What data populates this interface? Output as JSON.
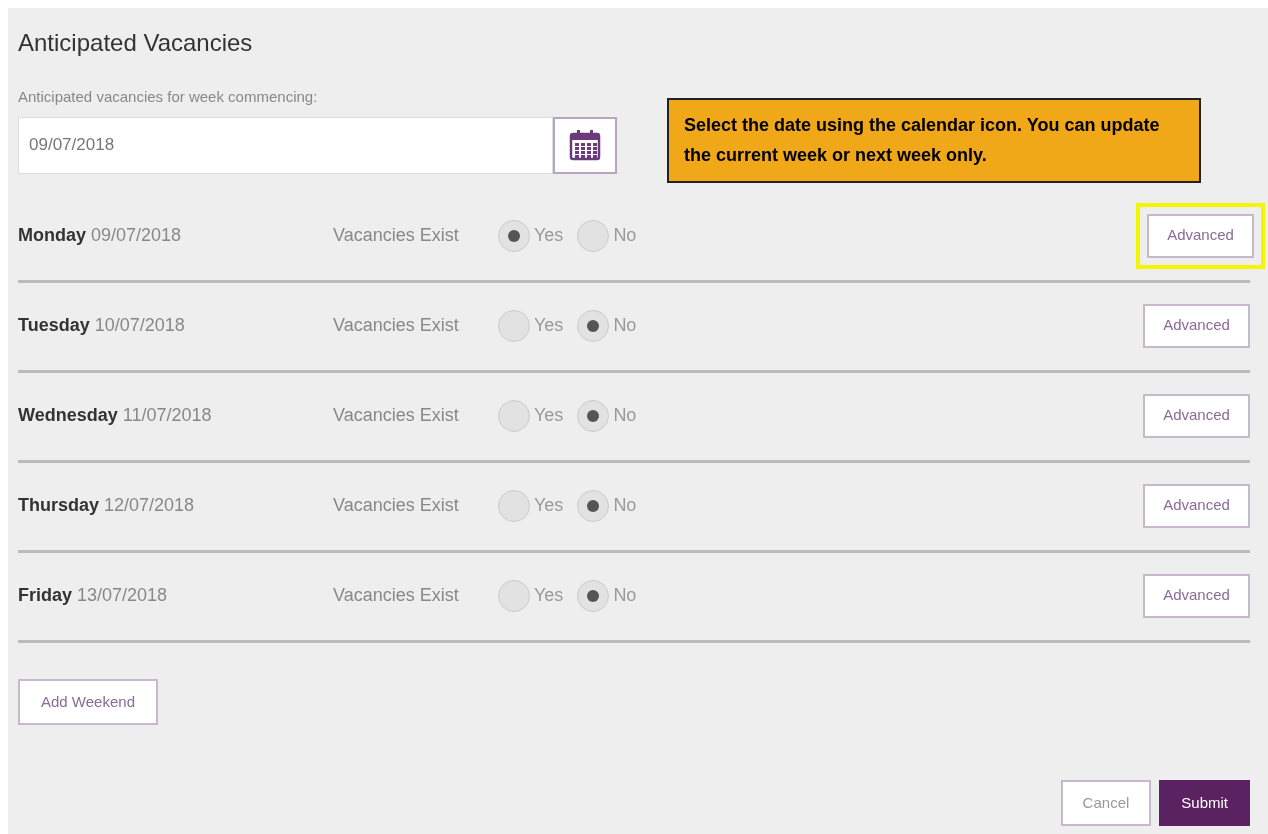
{
  "title": "Anticipated Vacancies",
  "week_field": {
    "label": "Anticipated vacancies for week commencing:",
    "value": "09/07/2018"
  },
  "callout": {
    "text": "Select the date using the calendar icon. You can update the current week or next week only."
  },
  "days": [
    {
      "day": "Monday",
      "date": "09/07/2018",
      "question": "Vacancies Exist",
      "options": [
        {
          "label": "Yes",
          "selected": true
        },
        {
          "label": "No",
          "selected": false
        }
      ],
      "button": "Advanced",
      "highlighted": true
    },
    {
      "day": "Tuesday",
      "date": "10/07/2018",
      "question": "Vacancies Exist",
      "options": [
        {
          "label": "Yes",
          "selected": false
        },
        {
          "label": "No",
          "selected": true
        }
      ],
      "button": "Advanced",
      "highlighted": false
    },
    {
      "day": "Wednesday",
      "date": "11/07/2018",
      "question": "Vacancies Exist",
      "options": [
        {
          "label": "Yes",
          "selected": false
        },
        {
          "label": "No",
          "selected": true
        }
      ],
      "button": "Advanced",
      "highlighted": false
    },
    {
      "day": "Thursday",
      "date": "12/07/2018",
      "question": "Vacancies Exist",
      "options": [
        {
          "label": "Yes",
          "selected": false
        },
        {
          "label": "No",
          "selected": true
        }
      ],
      "button": "Advanced",
      "highlighted": false
    },
    {
      "day": "Friday",
      "date": "13/07/2018",
      "question": "Vacancies Exist",
      "options": [
        {
          "label": "Yes",
          "selected": false
        },
        {
          "label": "No",
          "selected": true
        }
      ],
      "button": "Advanced",
      "highlighted": false
    }
  ],
  "add_button": "Add Weekend",
  "footer_buttons": [
    {
      "label": "Cancel",
      "kind": "secondary"
    },
    {
      "label": "Submit",
      "kind": "primary"
    }
  ]
}
